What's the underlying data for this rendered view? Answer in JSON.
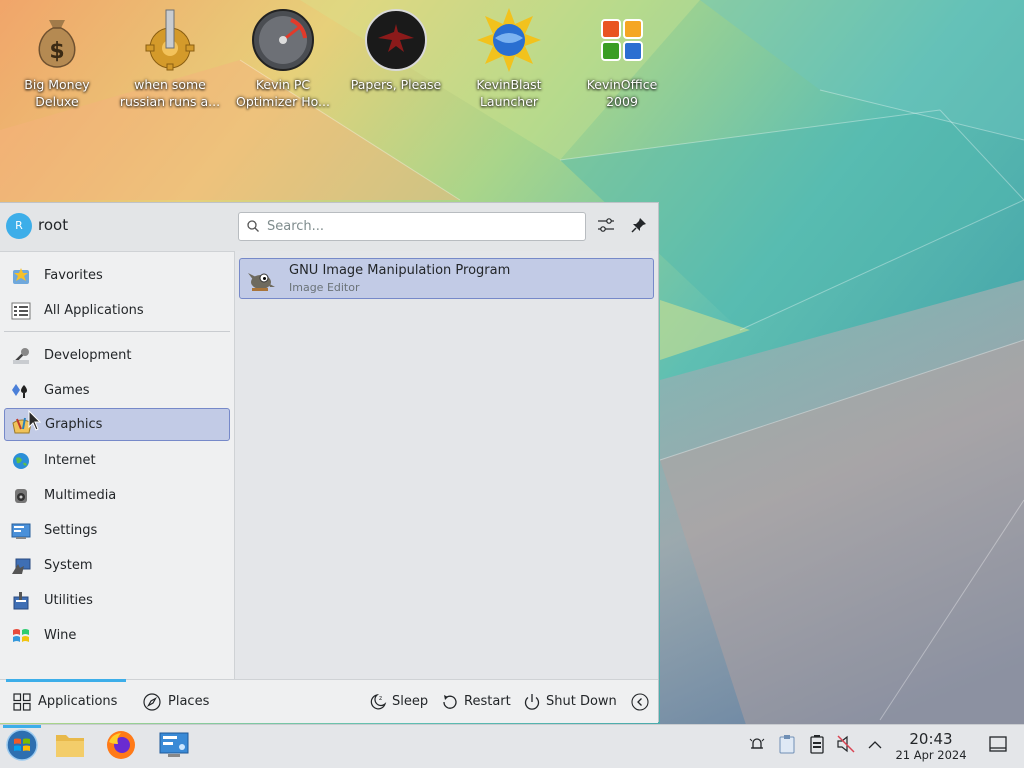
{
  "desktop": {
    "icons": [
      {
        "label": "Big Money\nDeluxe",
        "icon": "money-bag-icon"
      },
      {
        "label": "when some\nrussian runs a...",
        "icon": "gear-icon"
      },
      {
        "label": "Kevin PC\nOptimizer Ho...",
        "icon": "speedometer-icon"
      },
      {
        "label": "Papers, Please",
        "icon": "eagle-emblem-icon"
      },
      {
        "label": "KevinBlast\nLauncher",
        "icon": "globe-sun-icon"
      },
      {
        "label": "KevinOffice\n2009",
        "icon": "office-logo-icon"
      }
    ]
  },
  "launcher": {
    "user": {
      "name": "root",
      "avatar_letter": "R"
    },
    "search": {
      "placeholder": "Search...",
      "value": ""
    },
    "categories": [
      {
        "label": "Favorites",
        "icon": "favorites-icon"
      },
      {
        "label": "All Applications",
        "icon": "grid-icon"
      },
      {
        "label": "Development",
        "icon": "development-icon"
      },
      {
        "label": "Games",
        "icon": "games-icon"
      },
      {
        "label": "Graphics",
        "icon": "graphics-icon",
        "selected": true
      },
      {
        "label": "Internet",
        "icon": "globe-icon"
      },
      {
        "label": "Multimedia",
        "icon": "multimedia-icon"
      },
      {
        "label": "Settings",
        "icon": "settings-icon"
      },
      {
        "label": "System",
        "icon": "system-icon"
      },
      {
        "label": "Utilities",
        "icon": "utilities-icon"
      },
      {
        "label": "Wine",
        "icon": "wine-icon"
      }
    ],
    "apps": [
      {
        "name": "GNU Image Manipulation Program",
        "description": "Image Editor",
        "icon": "gimp-icon"
      }
    ],
    "footer": {
      "tabs": [
        {
          "label": "Applications",
          "icon": "applications-icon",
          "active": true
        },
        {
          "label": "Places",
          "icon": "compass-icon"
        }
      ],
      "power": [
        {
          "label": "Sleep",
          "icon": "sleep-icon"
        },
        {
          "label": "Restart",
          "icon": "restart-icon"
        },
        {
          "label": "Shut Down",
          "icon": "power-icon"
        }
      ]
    }
  },
  "panel": {
    "tasks": [
      "start-menu-icon",
      "file-manager-icon",
      "firefox-icon",
      "system-settings-icon"
    ],
    "tray": [
      "notifications-icon",
      "clipboard-icon",
      "battery-icon",
      "volume-muted-icon",
      "expand-tray-icon"
    ],
    "clock": {
      "time": "20:43",
      "date": "21 Apr 2024"
    }
  },
  "colors": {
    "accent": "#3daee9",
    "selection": "#c2cbe6",
    "selection_border": "#7689c9"
  }
}
